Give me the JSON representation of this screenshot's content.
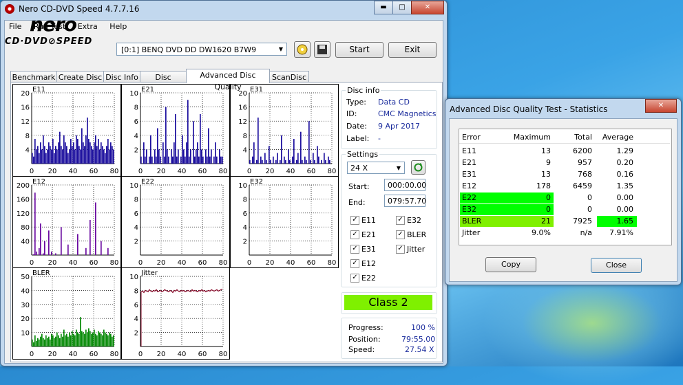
{
  "main_window": {
    "title": "Nero CD-DVD Speed 4.7.7.16",
    "controls": {
      "minimize": "▬",
      "maximize": "□",
      "close": "✕"
    },
    "menu": [
      "File",
      "Run Test",
      "Extra",
      "Help"
    ],
    "logo_top": "nero",
    "logo_bottom": "CD·DVD⊘SPEED",
    "drive": "[0:1]   BENQ DVD DD DW1620 B7W9",
    "start_label": "Start",
    "exit_label": "Exit",
    "tabs": [
      "Benchmark",
      "Create Disc",
      "Disc Info",
      "Disc Quality",
      "Advanced Disc Quality",
      "ScanDisc"
    ],
    "active_tab": "Advanced Disc Quality"
  },
  "disc_info": {
    "title": "Disc info",
    "rows": [
      {
        "key": "Type:",
        "value": "Data CD"
      },
      {
        "key": "ID:",
        "value": "CMC Magnetics"
      },
      {
        "key": "Date:",
        "value": "9 Apr 2017"
      },
      {
        "key": "Label:",
        "value": "-"
      }
    ]
  },
  "settings": {
    "title": "Settings",
    "speed": "24 X",
    "start_label": "Start:",
    "start_value": "000:00.00",
    "end_label": "End:",
    "end_value": "079:57.70",
    "checkboxes_left": [
      "E11",
      "E21",
      "E31",
      "E12",
      "E22"
    ],
    "checkboxes_right": [
      "E32",
      "BLER",
      "Jitter"
    ]
  },
  "class_label": "Class 2",
  "progress": {
    "rows": [
      {
        "key": "Progress:",
        "value": "100 %"
      },
      {
        "key": "Position:",
        "value": "79:55.00"
      },
      {
        "key": "Speed:",
        "value": "27.54 X"
      }
    ]
  },
  "stats_window": {
    "title": "Advanced Disc Quality Test - Statistics",
    "close": "✕",
    "headers": [
      "Error",
      "Maximum",
      "Total",
      "Average"
    ],
    "rows": [
      {
        "error": "E11",
        "maximum": "13",
        "total": "6200",
        "average": "1.29"
      },
      {
        "error": "E21",
        "maximum": "9",
        "total": "957",
        "average": "0.20"
      },
      {
        "error": "E31",
        "maximum": "13",
        "total": "768",
        "average": "0.16"
      },
      {
        "error": "E12",
        "maximum": "178",
        "total": "6459",
        "average": "1.35"
      },
      {
        "error": "E22",
        "maximum": "0",
        "total": "0",
        "average": "0.00"
      },
      {
        "error": "E32",
        "maximum": "0",
        "total": "0",
        "average": "0.00"
      },
      {
        "error": "BLER",
        "maximum": "21",
        "total": "7925",
        "average": "1.65"
      },
      {
        "error": "Jitter",
        "maximum": "9.0%",
        "total": "n/a",
        "average": "7.91%"
      }
    ],
    "copy_label": "Copy",
    "close_label": "Close"
  },
  "colors": {
    "e_series": "#1c0f9e",
    "e12": "#6a0aa0",
    "bler": "#078a07",
    "jitter": "#8a0f2e",
    "highlight_green": "#00ff00",
    "class_green": "#7ff000"
  },
  "chart_data": [
    {
      "type": "bar",
      "title": "E11",
      "ylim": [
        0,
        20
      ],
      "yticks": [
        4,
        8,
        12,
        16,
        20
      ],
      "xticks": [
        0,
        20,
        40,
        60,
        80
      ],
      "xlim": [
        0,
        80
      ],
      "series": [
        {
          "values": [
            3,
            2,
            7,
            4,
            5,
            3,
            6,
            4,
            8,
            5,
            3,
            4,
            6,
            5,
            4,
            7,
            3,
            5,
            4,
            6,
            9,
            5,
            4,
            8,
            6,
            5,
            3,
            4,
            7,
            5,
            6,
            4,
            8,
            7,
            5,
            4,
            10,
            6,
            5,
            8,
            13,
            7,
            6,
            5,
            4,
            6,
            8,
            5,
            7,
            4,
            6,
            5,
            4,
            3,
            5,
            7,
            4,
            6,
            5,
            4
          ]
        }
      ]
    },
    {
      "type": "bar",
      "title": "E21",
      "ylim": [
        0,
        10
      ],
      "yticks": [
        2,
        4,
        6,
        8,
        10
      ],
      "xticks": [
        0,
        20,
        40,
        60,
        80
      ],
      "xlim": [
        0,
        80
      ],
      "series": [
        {
          "values": [
            1,
            0,
            3,
            1,
            2,
            0,
            1,
            4,
            1,
            0,
            2,
            1,
            5,
            2,
            1,
            0,
            3,
            1,
            8,
            2,
            1,
            0,
            2,
            1,
            3,
            7,
            1,
            2,
            0,
            1,
            4,
            2,
            1,
            3,
            9,
            1,
            2,
            0,
            6,
            1,
            2,
            3,
            1,
            7,
            2,
            1,
            0,
            2,
            1,
            5,
            1,
            2,
            0,
            1,
            3,
            1,
            0,
            2,
            1,
            1
          ]
        }
      ]
    },
    {
      "type": "bar",
      "title": "E31",
      "ylim": [
        0,
        20
      ],
      "yticks": [
        4,
        8,
        12,
        16,
        20
      ],
      "xticks": [
        0,
        20,
        40,
        60,
        80
      ],
      "xlim": [
        0,
        80
      ],
      "series": [
        {
          "values": [
            1,
            0,
            2,
            6,
            0,
            1,
            13,
            0,
            2,
            1,
            0,
            3,
            1,
            0,
            5,
            1,
            0,
            2,
            0,
            1,
            3,
            0,
            1,
            8,
            0,
            2,
            1,
            0,
            4,
            1,
            0,
            2,
            7,
            0,
            1,
            3,
            0,
            9,
            1,
            0,
            2,
            1,
            0,
            12,
            1,
            0,
            3,
            1,
            0,
            5,
            2,
            0,
            1,
            0,
            3,
            1,
            0,
            2,
            1,
            0
          ]
        }
      ]
    },
    {
      "type": "bar",
      "title": "E12",
      "ylim": [
        0,
        200
      ],
      "yticks": [
        40,
        80,
        120,
        160,
        200
      ],
      "xticks": [
        0,
        20,
        40,
        60,
        80
      ],
      "xlim": [
        0,
        80
      ],
      "series": [
        {
          "values": [
            0,
            2,
            178,
            10,
            0,
            20,
            90,
            0,
            5,
            40,
            0,
            0,
            70,
            0,
            10,
            0,
            0,
            5,
            0,
            0,
            0,
            80,
            0,
            0,
            0,
            0,
            30,
            0,
            0,
            0,
            0,
            0,
            0,
            60,
            0,
            0,
            0,
            0,
            0,
            20,
            0,
            0,
            100,
            0,
            0,
            0,
            150,
            0,
            0,
            0,
            40,
            0,
            0,
            0,
            0,
            20,
            0,
            0,
            0,
            0
          ]
        }
      ]
    },
    {
      "type": "bar",
      "title": "E22",
      "ylim": [
        0,
        10
      ],
      "yticks": [
        2,
        4,
        6,
        8,
        10
      ],
      "xticks": [
        0,
        20,
        40,
        60,
        80
      ],
      "xlim": [
        0,
        80
      ],
      "series": [
        {
          "values": []
        }
      ]
    },
    {
      "type": "bar",
      "title": "E32",
      "ylim": [
        0,
        10
      ],
      "yticks": [
        2,
        4,
        6,
        8,
        10
      ],
      "xticks": [
        0,
        20,
        40,
        60,
        80
      ],
      "xlim": [
        0,
        80
      ],
      "series": [
        {
          "values": []
        }
      ]
    },
    {
      "type": "bar",
      "title": "BLER",
      "ylim": [
        0,
        50
      ],
      "yticks": [
        10,
        20,
        30,
        40,
        50
      ],
      "xticks": [
        0,
        20,
        40,
        60,
        80
      ],
      "xlim": [
        0,
        80
      ],
      "series": [
        {
          "values": [
            5,
            3,
            8,
            4,
            6,
            5,
            7,
            9,
            6,
            5,
            8,
            6,
            7,
            5,
            9,
            8,
            6,
            7,
            10,
            8,
            6,
            9,
            7,
            12,
            8,
            9,
            7,
            10,
            8,
            11,
            9,
            8,
            12,
            10,
            9,
            21,
            11,
            10,
            9,
            12,
            10,
            13,
            11,
            9,
            10,
            12,
            9,
            8,
            11,
            10,
            9,
            8,
            12,
            10,
            9,
            8,
            10,
            9,
            7,
            8
          ]
        }
      ]
    },
    {
      "type": "line",
      "title": "Jitter",
      "ylim": [
        0,
        10
      ],
      "yticks": [
        2,
        4,
        6,
        8,
        10
      ],
      "xticks": [
        0,
        20,
        40,
        60,
        80
      ],
      "xlim": [
        0,
        80
      ],
      "series": [
        {
          "values": [
            7.8,
            7.9,
            7.7,
            8.0,
            7.9,
            7.8,
            8.1,
            7.9,
            7.8,
            8.0,
            7.9,
            8.1,
            7.8,
            7.9,
            8.0,
            7.8,
            7.9,
            8.1,
            8.0,
            7.9,
            7.8,
            8.0,
            7.9,
            7.7,
            8.0,
            7.9,
            8.1,
            7.9,
            7.8,
            8.0,
            7.9,
            8.0,
            7.8,
            7.9,
            8.0,
            7.9,
            7.8,
            8.1,
            7.9,
            8.0,
            7.9,
            7.8,
            8.0,
            7.9,
            8.1,
            7.9,
            8.0,
            7.8,
            7.9,
            8.0,
            7.9,
            8.1,
            8.0,
            7.9,
            8.0,
            8.1,
            7.9,
            8.0,
            8.1,
            8.2
          ]
        }
      ]
    }
  ]
}
